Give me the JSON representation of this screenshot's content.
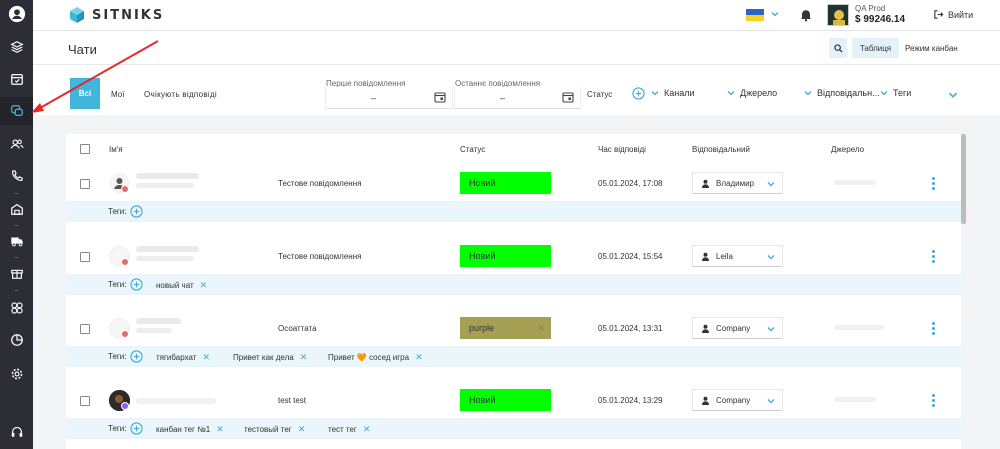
{
  "brand": {
    "name": "SITNIKS"
  },
  "account": {
    "name": "QA Prod",
    "balance": "$ 99246.14",
    "logout_label": "Вийти"
  },
  "page": {
    "title": "Чати"
  },
  "view": {
    "table_label": "Таблиця",
    "kanban_label": "Режим канбан"
  },
  "filters": {
    "tab_all": "Всі",
    "tab_mine": "Мої",
    "tab_waiting": "Очікують відповіді",
    "first_message_label": "Перше повідомлення",
    "last_message_label": "Останнє повідомлення",
    "date_placeholder": "–",
    "status_label": "Статус",
    "channels_label": "Канали",
    "source_label": "Джерело",
    "responsible_label": "Відповідальн...",
    "tags_label": "Теги"
  },
  "table": {
    "headers": {
      "name": "Ім'я",
      "status": "Статус",
      "response_time": "Час відповіді",
      "responsible": "Відповідальний",
      "source": "Джерело"
    },
    "tags_label": "Теги:",
    "rows": [
      {
        "message": "Тестове повідомлення",
        "status": "Новий",
        "time": "05.01.2024, 17:08",
        "responsible": "Владимир",
        "tags": []
      },
      {
        "message": "Тестове повідомлення",
        "status": "Новий",
        "time": "05.01.2024, 15:54",
        "responsible": "Leila",
        "tags": [
          "новый чат"
        ]
      },
      {
        "message": "Осоаттата",
        "status": "purple",
        "time": "05.01.2024, 13:31",
        "responsible": "Company",
        "tags": [
          "тягибархат",
          "Привет как дела",
          "Привет 🧡 сосед игра"
        ]
      },
      {
        "message": "test test",
        "status": "Новий",
        "time": "05.01.2024, 13:29",
        "responsible": "Company",
        "tags": [
          "канбан тег №1",
          "тестовый тег",
          "тест тег"
        ]
      }
    ]
  },
  "colors": {
    "sidebar": "#2d2d35",
    "accent": "#41b6dc",
    "status_new": "#00ff00",
    "status_purple": "#a6a054",
    "tags_row_bg": "#eaf6fa",
    "annotation": "#e8262b"
  },
  "icons": [
    "user-circle-icon",
    "layers-icon",
    "calendar-icon",
    "chat-icon",
    "users-icon",
    "phone-icon",
    "warehouse-icon",
    "truck-icon",
    "gift-icon",
    "integrations-icon",
    "chart-pie-icon",
    "settings-icon",
    "headset-icon",
    "bell-icon",
    "logout-icon",
    "search-icon",
    "plus-circle-icon",
    "chevron-down-icon",
    "close-icon",
    "kebab-icon"
  ]
}
